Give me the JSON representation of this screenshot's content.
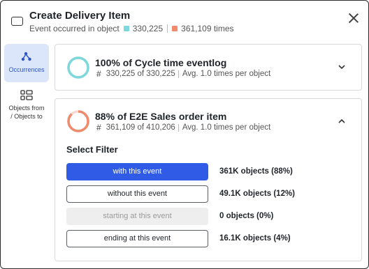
{
  "header": {
    "title": "Create Delivery Item",
    "subtitle_prefix": "Event occurred in object",
    "count_a": "330,225",
    "count_b": "361,109 times",
    "color_a": "#7dd8de",
    "color_b": "#ef8a6d"
  },
  "sidebar": {
    "items": [
      {
        "label": "Occurrences",
        "icon": "graph-nodes-icon",
        "active": true
      },
      {
        "label_line1": "Objects from",
        "label_line2": "/ Objects to",
        "icon": "object-list-icon",
        "active": false
      }
    ]
  },
  "cards": [
    {
      "title": "100% of Cycle time eventlog",
      "hash": "#",
      "stat": "330,225 of 330,225",
      "avg": "Avg. 1.0 times per object",
      "percent": 100,
      "ring_color": "#7dd8de",
      "expanded": false
    },
    {
      "title": "88% of E2E Sales order item",
      "hash": "#",
      "stat": "361,109 of 410,206",
      "avg": "Avg. 1.0 times per object",
      "percent": 88,
      "ring_color": "#ef8a6d",
      "expanded": true
    }
  ],
  "filter": {
    "label": "Select Filter",
    "options": [
      {
        "label": "with this event",
        "count": "361K objects (88%)",
        "state": "selected"
      },
      {
        "label": "without this event",
        "count": "49.1K objects (12%)",
        "state": "default"
      },
      {
        "label": "starting at this event",
        "count": "0 objects (0%)",
        "state": "disabled"
      },
      {
        "label": "ending at this event",
        "count": "16.1K objects (4%)",
        "state": "default"
      }
    ]
  },
  "colors": {
    "accent": "#2f5be7",
    "active_tab_bg": "#dbe6fb"
  }
}
